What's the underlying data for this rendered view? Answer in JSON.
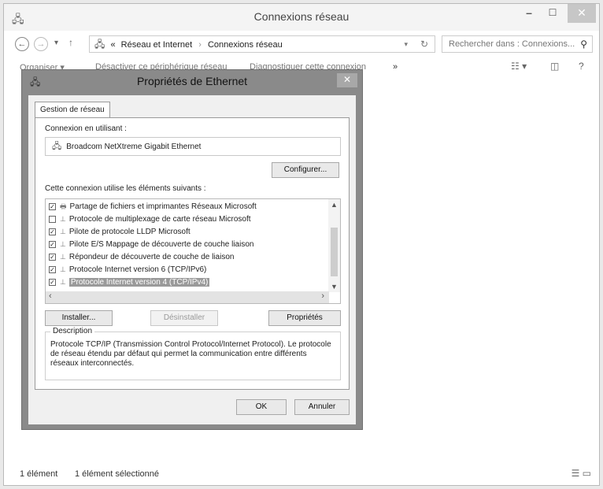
{
  "window": {
    "title": "Connexions réseau",
    "min_glyph": "–",
    "max_glyph": "☐",
    "close_glyph": "✕"
  },
  "address": {
    "overflow": "«",
    "crumbs": [
      "Réseau et Internet",
      "Connexions réseau"
    ],
    "separator": "›",
    "search_placeholder": "Rechercher dans : Connexions..."
  },
  "toolbar": {
    "organize": "Organiser ▾",
    "disable": "Désactiver ce périphérique réseau",
    "diagnose": "Diagnostiquer cette connexion",
    "more": "»"
  },
  "status": {
    "count": "1 élément",
    "selected": "1 élément sélectionné"
  },
  "dialog": {
    "title": "Propriétés de Ethernet",
    "tab": "Gestion de réseau",
    "connect_using_label": "Connexion en utilisant :",
    "adapter": "Broadcom NetXtreme Gigabit Ethernet",
    "configure_button": "Configurer...",
    "items_label": "Cette connexion utilise les éléments suivants :",
    "items": [
      {
        "label": "Partage de fichiers et imprimantes Réseaux Microsoft",
        "checked": true,
        "icon": "printer-icon"
      },
      {
        "label": "Protocole de multiplexage de carte réseau Microsoft",
        "checked": false,
        "icon": "protocol-icon"
      },
      {
        "label": "Pilote de protocole LLDP Microsoft",
        "checked": true,
        "icon": "protocol-icon"
      },
      {
        "label": "Pilote E/S Mappage de découverte de couche liaison",
        "checked": true,
        "icon": "protocol-icon"
      },
      {
        "label": "Répondeur de découverte de couche de liaison",
        "checked": true,
        "icon": "protocol-icon"
      },
      {
        "label": "Protocole Internet version 6 (TCP/IPv6)",
        "checked": true,
        "icon": "protocol-icon"
      },
      {
        "label": "Protocole Internet version 4 (TCP/IPv4)",
        "checked": true,
        "icon": "protocol-icon",
        "selected": true
      }
    ],
    "install_button": "Installer...",
    "uninstall_button": "Désinstaller",
    "properties_button": "Propriétés",
    "description_title": "Description",
    "description_text": "Protocole TCP/IP (Transmission Control Protocol/Internet Protocol). Le protocole de réseau étendu par défaut qui permet la communication entre différents réseaux interconnectés.",
    "ok_button": "OK",
    "cancel_button": "Annuler"
  }
}
